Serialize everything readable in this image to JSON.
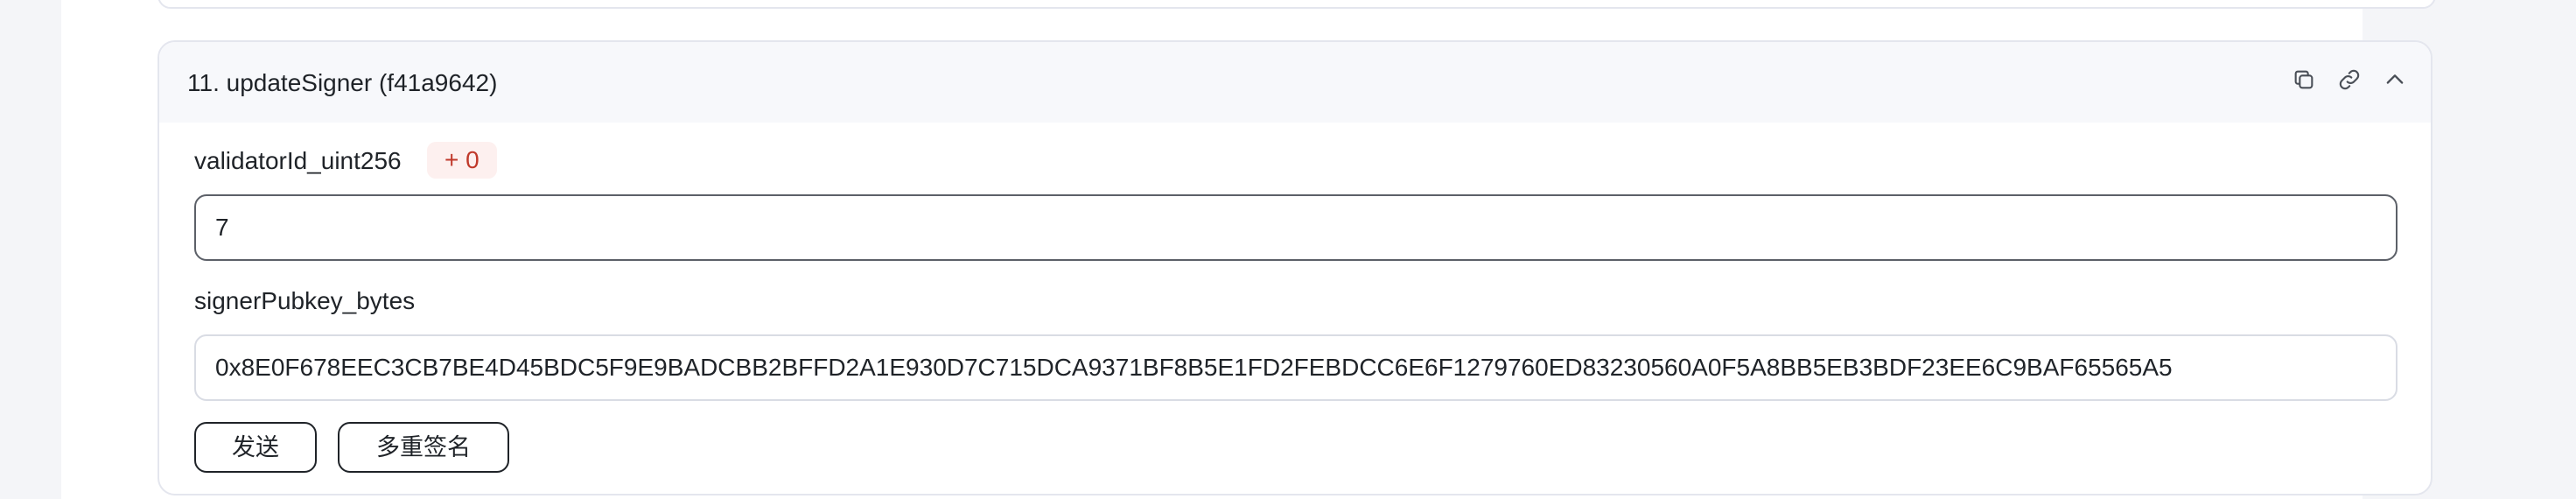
{
  "function_card": {
    "title": "11. updateSigner (f41a9642)",
    "actions": [
      {
        "icon": "copy-icon"
      },
      {
        "icon": "link-icon"
      },
      {
        "icon": "chevron-up-icon"
      }
    ]
  },
  "fields": [
    {
      "label": "validatorId_uint256",
      "badge": "+ 0",
      "value": "7"
    },
    {
      "label": "signerPubkey_bytes",
      "value": "0x8E0F678EEC3CB7BE4D45BDC5F9E9BADCBB2BFFD2A1E930D7C715DCA9371BF8B5E1FD2FEBDCC6E6F1279760ED83230560A0F5A8BB5EB3BDF23EE6C9BAF65565A5"
    }
  ],
  "buttons": {
    "send_label": "发送",
    "multisig_label": "多重签名"
  },
  "colors": {
    "badge_bg": "#fdf0ef",
    "badge_text": "#c0392b",
    "card_border": "#e4e6ee"
  }
}
